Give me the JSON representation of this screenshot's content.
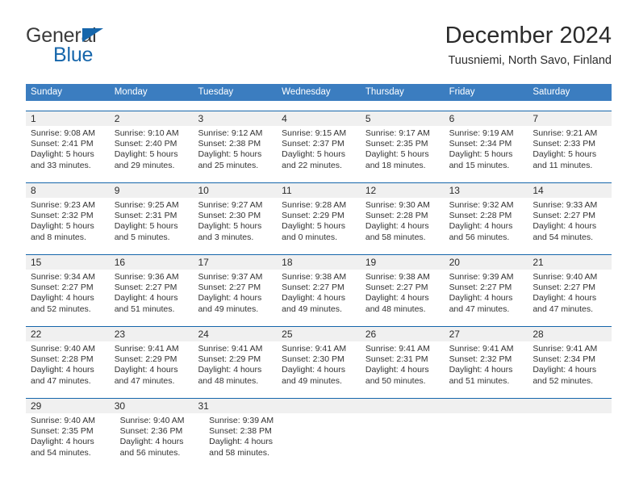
{
  "brand": {
    "name_part1": "General",
    "name_part2": "Blue",
    "flag_icon": "brand-flag-icon",
    "accent_color": "#1666ab"
  },
  "header": {
    "title": "December 2024",
    "subtitle": "Tuusniemi, North Savo, Finland"
  },
  "colors": {
    "header_blue": "#3b7dc0",
    "rule_blue": "#1666ab",
    "daynum_band": "#f0f0f0"
  },
  "weekdays": [
    "Sunday",
    "Monday",
    "Tuesday",
    "Wednesday",
    "Thursday",
    "Friday",
    "Saturday"
  ],
  "weeks": [
    {
      "days": [
        {
          "num": "1",
          "sunrise": "Sunrise: 9:08 AM",
          "sunset": "Sunset: 2:41 PM",
          "daylight1": "Daylight: 5 hours",
          "daylight2": "and 33 minutes."
        },
        {
          "num": "2",
          "sunrise": "Sunrise: 9:10 AM",
          "sunset": "Sunset: 2:40 PM",
          "daylight1": "Daylight: 5 hours",
          "daylight2": "and 29 minutes."
        },
        {
          "num": "3",
          "sunrise": "Sunrise: 9:12 AM",
          "sunset": "Sunset: 2:38 PM",
          "daylight1": "Daylight: 5 hours",
          "daylight2": "and 25 minutes."
        },
        {
          "num": "4",
          "sunrise": "Sunrise: 9:15 AM",
          "sunset": "Sunset: 2:37 PM",
          "daylight1": "Daylight: 5 hours",
          "daylight2": "and 22 minutes."
        },
        {
          "num": "5",
          "sunrise": "Sunrise: 9:17 AM",
          "sunset": "Sunset: 2:35 PM",
          "daylight1": "Daylight: 5 hours",
          "daylight2": "and 18 minutes."
        },
        {
          "num": "6",
          "sunrise": "Sunrise: 9:19 AM",
          "sunset": "Sunset: 2:34 PM",
          "daylight1": "Daylight: 5 hours",
          "daylight2": "and 15 minutes."
        },
        {
          "num": "7",
          "sunrise": "Sunrise: 9:21 AM",
          "sunset": "Sunset: 2:33 PM",
          "daylight1": "Daylight: 5 hours",
          "daylight2": "and 11 minutes."
        }
      ]
    },
    {
      "days": [
        {
          "num": "8",
          "sunrise": "Sunrise: 9:23 AM",
          "sunset": "Sunset: 2:32 PM",
          "daylight1": "Daylight: 5 hours",
          "daylight2": "and 8 minutes."
        },
        {
          "num": "9",
          "sunrise": "Sunrise: 9:25 AM",
          "sunset": "Sunset: 2:31 PM",
          "daylight1": "Daylight: 5 hours",
          "daylight2": "and 5 minutes."
        },
        {
          "num": "10",
          "sunrise": "Sunrise: 9:27 AM",
          "sunset": "Sunset: 2:30 PM",
          "daylight1": "Daylight: 5 hours",
          "daylight2": "and 3 minutes."
        },
        {
          "num": "11",
          "sunrise": "Sunrise: 9:28 AM",
          "sunset": "Sunset: 2:29 PM",
          "daylight1": "Daylight: 5 hours",
          "daylight2": "and 0 minutes."
        },
        {
          "num": "12",
          "sunrise": "Sunrise: 9:30 AM",
          "sunset": "Sunset: 2:28 PM",
          "daylight1": "Daylight: 4 hours",
          "daylight2": "and 58 minutes."
        },
        {
          "num": "13",
          "sunrise": "Sunrise: 9:32 AM",
          "sunset": "Sunset: 2:28 PM",
          "daylight1": "Daylight: 4 hours",
          "daylight2": "and 56 minutes."
        },
        {
          "num": "14",
          "sunrise": "Sunrise: 9:33 AM",
          "sunset": "Sunset: 2:27 PM",
          "daylight1": "Daylight: 4 hours",
          "daylight2": "and 54 minutes."
        }
      ]
    },
    {
      "days": [
        {
          "num": "15",
          "sunrise": "Sunrise: 9:34 AM",
          "sunset": "Sunset: 2:27 PM",
          "daylight1": "Daylight: 4 hours",
          "daylight2": "and 52 minutes."
        },
        {
          "num": "16",
          "sunrise": "Sunrise: 9:36 AM",
          "sunset": "Sunset: 2:27 PM",
          "daylight1": "Daylight: 4 hours",
          "daylight2": "and 51 minutes."
        },
        {
          "num": "17",
          "sunrise": "Sunrise: 9:37 AM",
          "sunset": "Sunset: 2:27 PM",
          "daylight1": "Daylight: 4 hours",
          "daylight2": "and 49 minutes."
        },
        {
          "num": "18",
          "sunrise": "Sunrise: 9:38 AM",
          "sunset": "Sunset: 2:27 PM",
          "daylight1": "Daylight: 4 hours",
          "daylight2": "and 49 minutes."
        },
        {
          "num": "19",
          "sunrise": "Sunrise: 9:38 AM",
          "sunset": "Sunset: 2:27 PM",
          "daylight1": "Daylight: 4 hours",
          "daylight2": "and 48 minutes."
        },
        {
          "num": "20",
          "sunrise": "Sunrise: 9:39 AM",
          "sunset": "Sunset: 2:27 PM",
          "daylight1": "Daylight: 4 hours",
          "daylight2": "and 47 minutes."
        },
        {
          "num": "21",
          "sunrise": "Sunrise: 9:40 AM",
          "sunset": "Sunset: 2:27 PM",
          "daylight1": "Daylight: 4 hours",
          "daylight2": "and 47 minutes."
        }
      ]
    },
    {
      "days": [
        {
          "num": "22",
          "sunrise": "Sunrise: 9:40 AM",
          "sunset": "Sunset: 2:28 PM",
          "daylight1": "Daylight: 4 hours",
          "daylight2": "and 47 minutes."
        },
        {
          "num": "23",
          "sunrise": "Sunrise: 9:41 AM",
          "sunset": "Sunset: 2:29 PM",
          "daylight1": "Daylight: 4 hours",
          "daylight2": "and 47 minutes."
        },
        {
          "num": "24",
          "sunrise": "Sunrise: 9:41 AM",
          "sunset": "Sunset: 2:29 PM",
          "daylight1": "Daylight: 4 hours",
          "daylight2": "and 48 minutes."
        },
        {
          "num": "25",
          "sunrise": "Sunrise: 9:41 AM",
          "sunset": "Sunset: 2:30 PM",
          "daylight1": "Daylight: 4 hours",
          "daylight2": "and 49 minutes."
        },
        {
          "num": "26",
          "sunrise": "Sunrise: 9:41 AM",
          "sunset": "Sunset: 2:31 PM",
          "daylight1": "Daylight: 4 hours",
          "daylight2": "and 50 minutes."
        },
        {
          "num": "27",
          "sunrise": "Sunrise: 9:41 AM",
          "sunset": "Sunset: 2:32 PM",
          "daylight1": "Daylight: 4 hours",
          "daylight2": "and 51 minutes."
        },
        {
          "num": "28",
          "sunrise": "Sunrise: 9:41 AM",
          "sunset": "Sunset: 2:34 PM",
          "daylight1": "Daylight: 4 hours",
          "daylight2": "and 52 minutes."
        }
      ]
    },
    {
      "days": [
        {
          "num": "29",
          "sunrise": "Sunrise: 9:40 AM",
          "sunset": "Sunset: 2:35 PM",
          "daylight1": "Daylight: 4 hours",
          "daylight2": "and 54 minutes."
        },
        {
          "num": "30",
          "sunrise": "Sunrise: 9:40 AM",
          "sunset": "Sunset: 2:36 PM",
          "daylight1": "Daylight: 4 hours",
          "daylight2": "and 56 minutes."
        },
        {
          "num": "31",
          "sunrise": "Sunrise: 9:39 AM",
          "sunset": "Sunset: 2:38 PM",
          "daylight1": "Daylight: 4 hours",
          "daylight2": "and 58 minutes."
        },
        {
          "num": "",
          "sunrise": "",
          "sunset": "",
          "daylight1": "",
          "daylight2": ""
        },
        {
          "num": "",
          "sunrise": "",
          "sunset": "",
          "daylight1": "",
          "daylight2": ""
        },
        {
          "num": "",
          "sunrise": "",
          "sunset": "",
          "daylight1": "",
          "daylight2": ""
        },
        {
          "num": "",
          "sunrise": "",
          "sunset": "",
          "daylight1": "",
          "daylight2": ""
        }
      ]
    }
  ]
}
